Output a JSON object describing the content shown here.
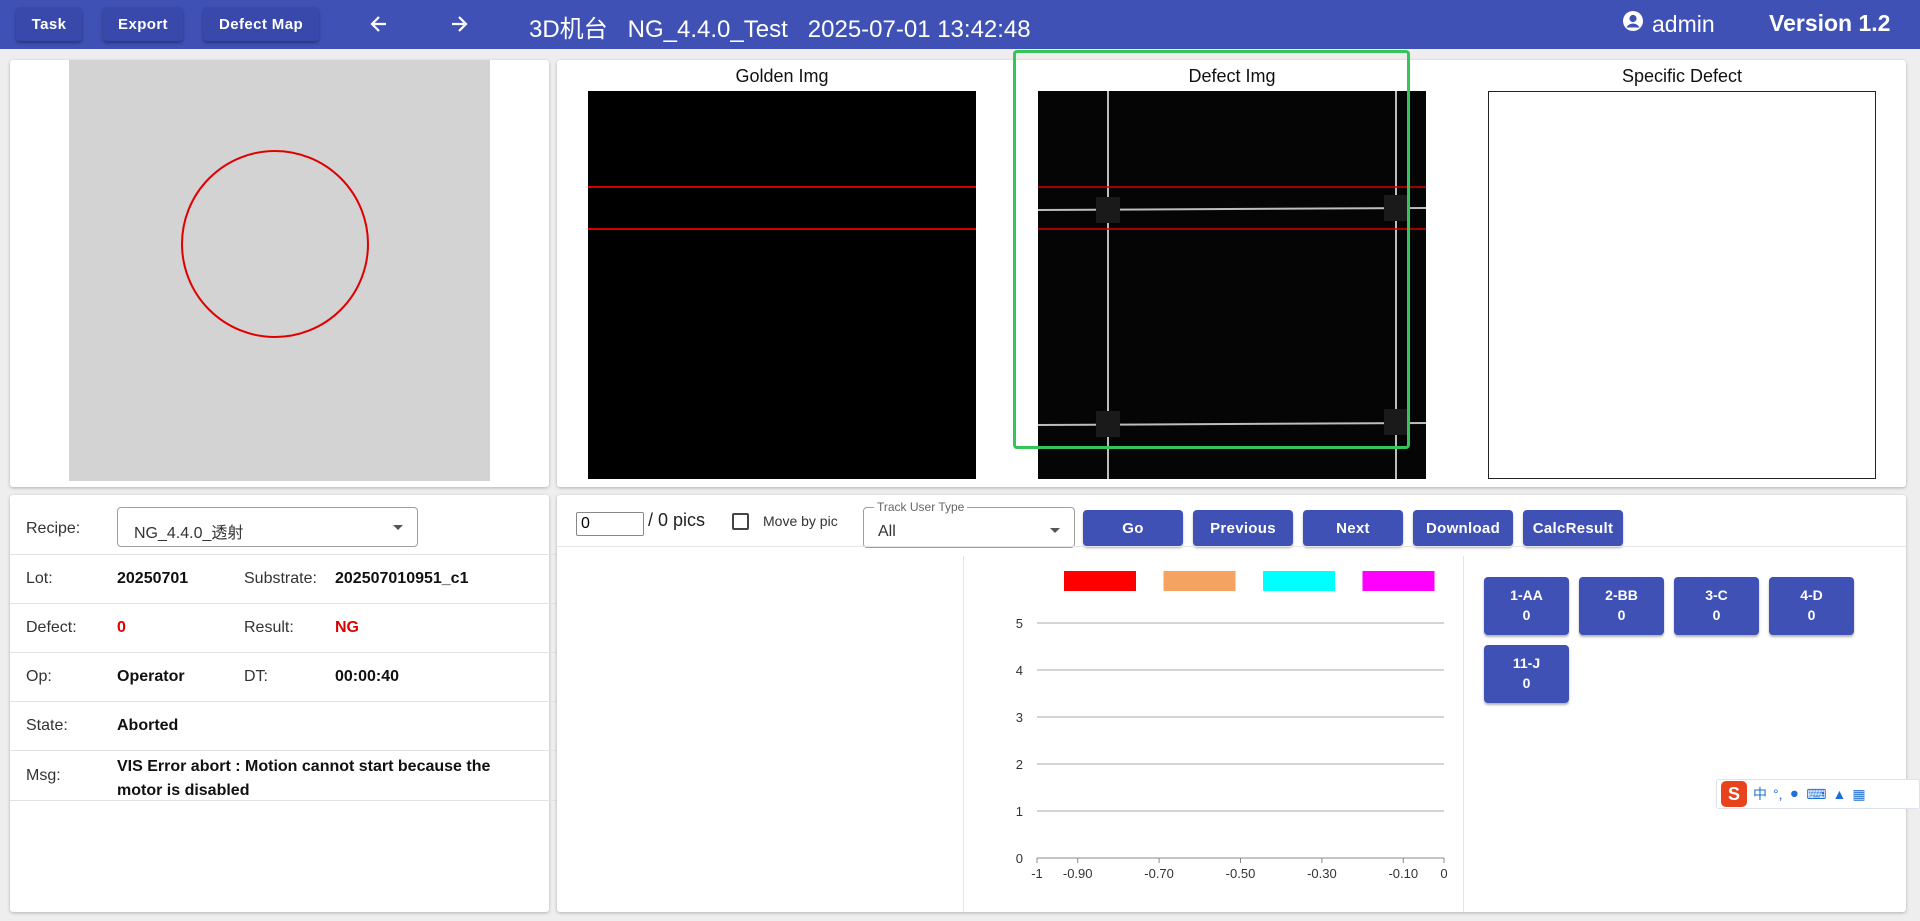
{
  "header": {
    "task_label": "Task",
    "export_label": "Export",
    "defect_map_label": "Defect Map",
    "title": "3D机台   NG_4.4.0_Test   2025-07-01 13:42:48",
    "user": "admin",
    "version": "Version 1.2"
  },
  "images": {
    "golden_title": "Golden Img",
    "defect_title": "Defect Img",
    "specific_title": "Specific Defect"
  },
  "info": {
    "recipe_label": "Recipe:",
    "recipe_value": "NG_4.4.0_透射",
    "lot_label": "Lot:",
    "lot_value": "20250701",
    "substrate_label": "Substrate:",
    "substrate_value": "202507010951_c1",
    "defect_label": "Defect:",
    "defect_value": "0",
    "result_label": "Result:",
    "result_value": "NG",
    "op_label": "Op:",
    "op_value": "Operator",
    "dt_label": "DT:",
    "dt_value": "00:00:40",
    "state_label": "State:",
    "state_value": "Aborted",
    "msg_label": "Msg:",
    "msg_value": "VIS Error abort : Motion cannot start because the motor is disabled",
    "alert_color": "#e00000"
  },
  "toolbar": {
    "pic_value": "0",
    "pics_text": "/ 0 pics",
    "move_by_pic_label": "Move by pic",
    "track_label": "Track User Type",
    "track_value": "All",
    "go_label": "Go",
    "previous_label": "Previous",
    "next_label": "Next",
    "download_label": "Download",
    "calc_label": "CalcResult"
  },
  "chart_data": {
    "type": "bar",
    "legend_colors": [
      "#ff0000",
      "#f4a460",
      "#00ffff",
      "#ff00ff"
    ],
    "x_ticks": [
      "-1",
      "-0.90",
      "-0.70",
      "-0.50",
      "-0.30",
      "-0.10",
      "0"
    ],
    "y_ticks": [
      "0",
      "1",
      "2",
      "3",
      "4",
      "5"
    ],
    "xlim": [
      -1,
      0
    ],
    "ylim": [
      0,
      5
    ],
    "grid": true,
    "series": []
  },
  "stats": [
    {
      "name": "1-AA",
      "count": "0"
    },
    {
      "name": "2-BB",
      "count": "0"
    },
    {
      "name": "3-C",
      "count": "0"
    },
    {
      "name": "4-D",
      "count": "0"
    },
    {
      "name": "11-J",
      "count": "0"
    }
  ],
  "ime": {
    "label": "中"
  },
  "colors": {
    "primary": "#3f51b5",
    "highlight": "#33c45a",
    "marker": "#e00000"
  }
}
